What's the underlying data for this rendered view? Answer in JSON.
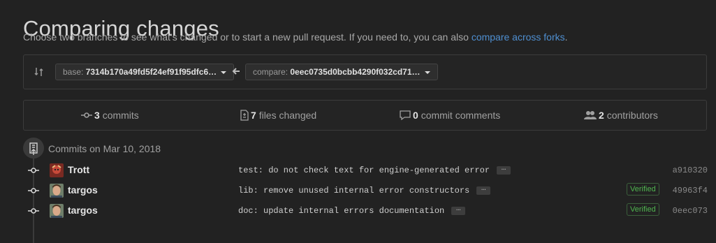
{
  "header": {
    "title": "Comparing changes",
    "subtitle_prefix": "Choose two branches to see what’s changed or to start a new pull request. If you need to, you can also ",
    "subtitle_link": "compare across forks",
    "subtitle_suffix": "."
  },
  "range": {
    "base_label": "base:",
    "base_value": "7314b170a49fd5f24ef91f95dfc6…",
    "compare_label": "compare:",
    "compare_value": "0eec0735d0bcbb4290f032cd71…"
  },
  "summary": {
    "commits_count": "3",
    "commits_label": "commits",
    "files_count": "7",
    "files_label": "files changed",
    "comments_count": "0",
    "comments_label": "commit comments",
    "contributors_count": "2",
    "contributors_label": "contributors"
  },
  "day": {
    "label": "Commits on Mar 10, 2018"
  },
  "commits": [
    {
      "author": "Trott",
      "message": "test: do not check text for engine-generated error",
      "ellipsis": "…",
      "verified": "",
      "sha": "a910320"
    },
    {
      "author": "targos",
      "message": "lib: remove unused internal error constructors",
      "ellipsis": "…",
      "verified": "Verified",
      "sha": "49963f4"
    },
    {
      "author": "targos",
      "message": "doc: update internal errors documentation",
      "ellipsis": "…",
      "verified": "Verified",
      "sha": "0eec073"
    }
  ],
  "colors": {
    "link": "#4f8fd1",
    "verified": "#4fb54f",
    "background": "#222222"
  }
}
